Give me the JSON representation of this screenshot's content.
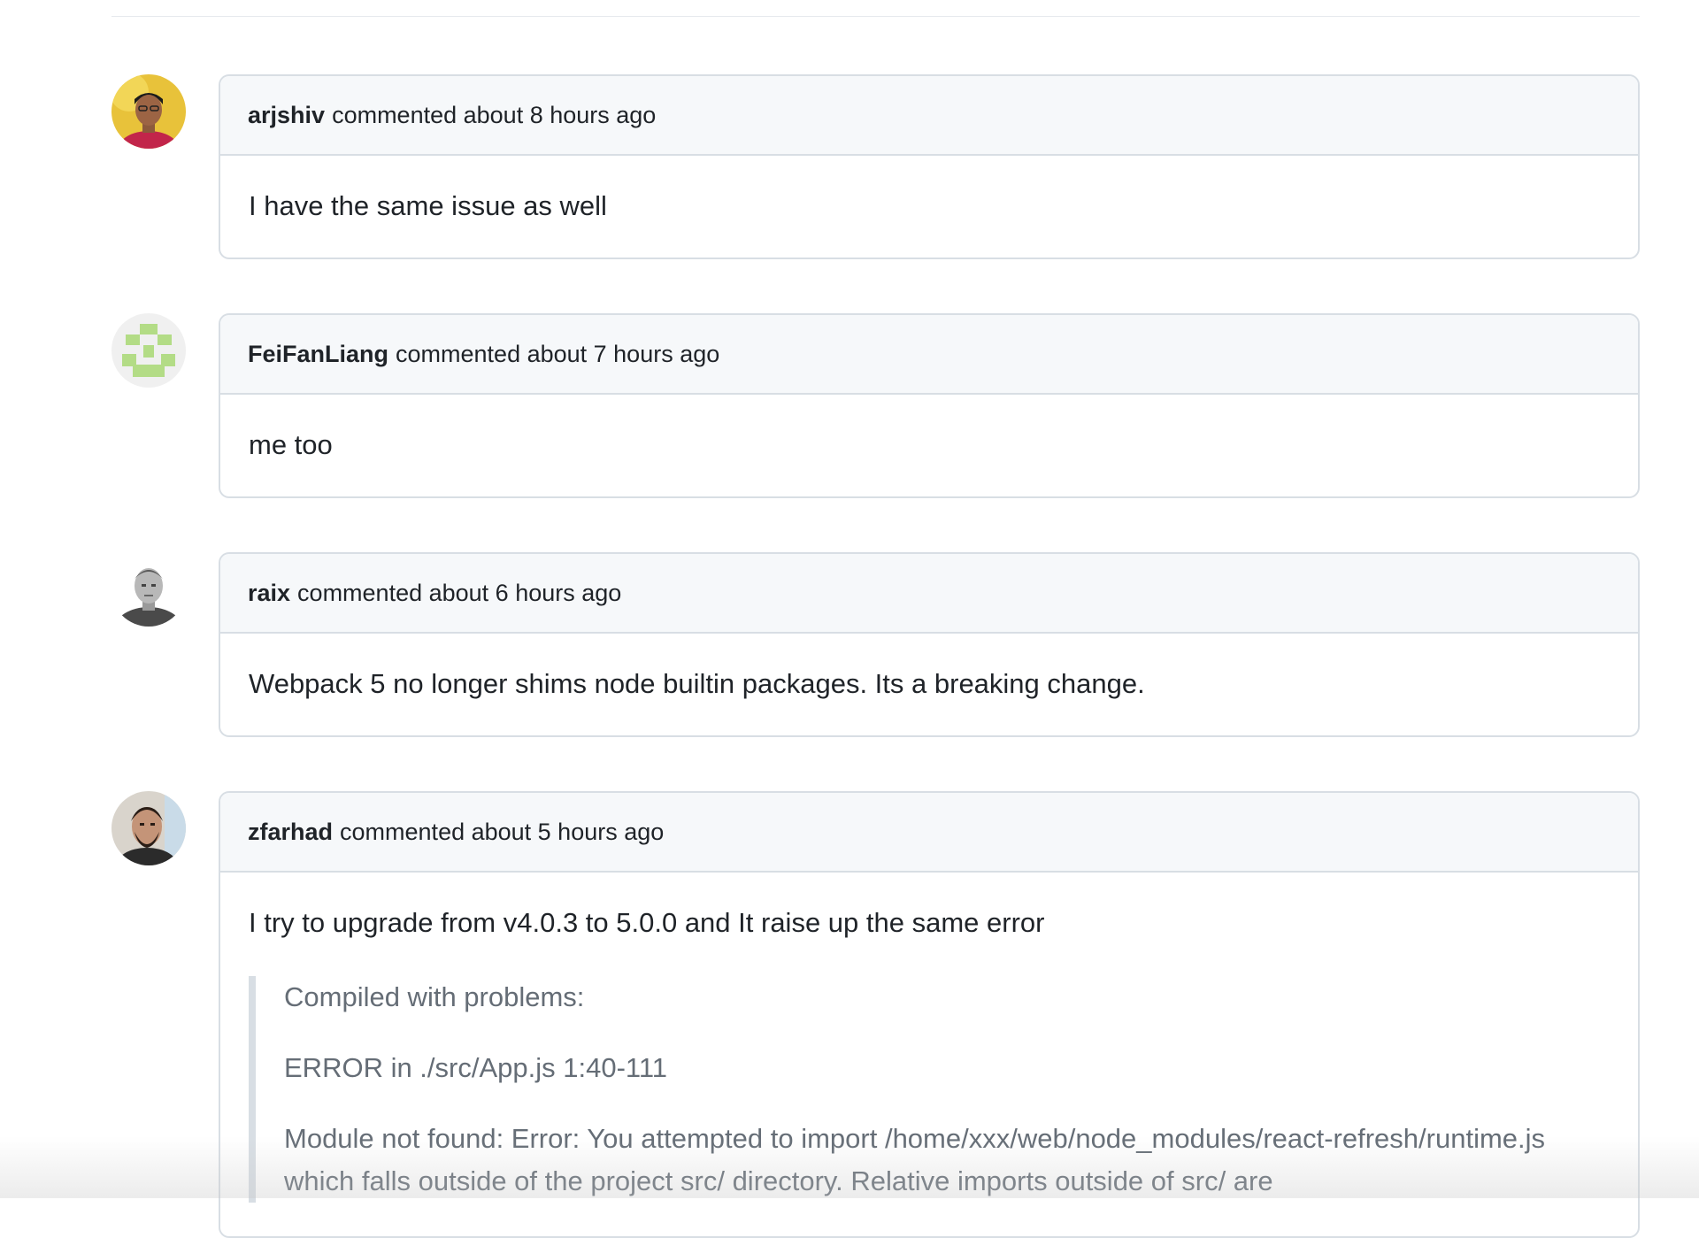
{
  "comments": [
    {
      "author": "arjshiv",
      "meta": "commented about 8 hours ago",
      "body": "I have the same issue as well"
    },
    {
      "author": "FeiFanLiang",
      "meta": "commented about 7 hours ago",
      "body": "me too"
    },
    {
      "author": "raix",
      "meta": "commented about 6 hours ago",
      "body": "Webpack 5 no longer shims node builtin packages. Its a breaking change."
    },
    {
      "author": "zfarhad",
      "meta": "commented about 5 hours ago",
      "body": "I try to upgrade from v4.0.3 to 5.0.0 and It raise up the same error",
      "quote": {
        "line1": "Compiled with problems:",
        "line2": "ERROR in ./src/App.js 1:40-111",
        "line3": "Module not found: Error: You attempted to import /home/xxx/web/node_modules/react-refresh/runtime.js which falls outside of the project src/ directory. Relative imports outside of src/ are"
      }
    }
  ],
  "colors": {
    "header_bg": "#f6f8fa",
    "border": "#d8dee4",
    "text": "#1f2328",
    "muted": "#656d76"
  }
}
